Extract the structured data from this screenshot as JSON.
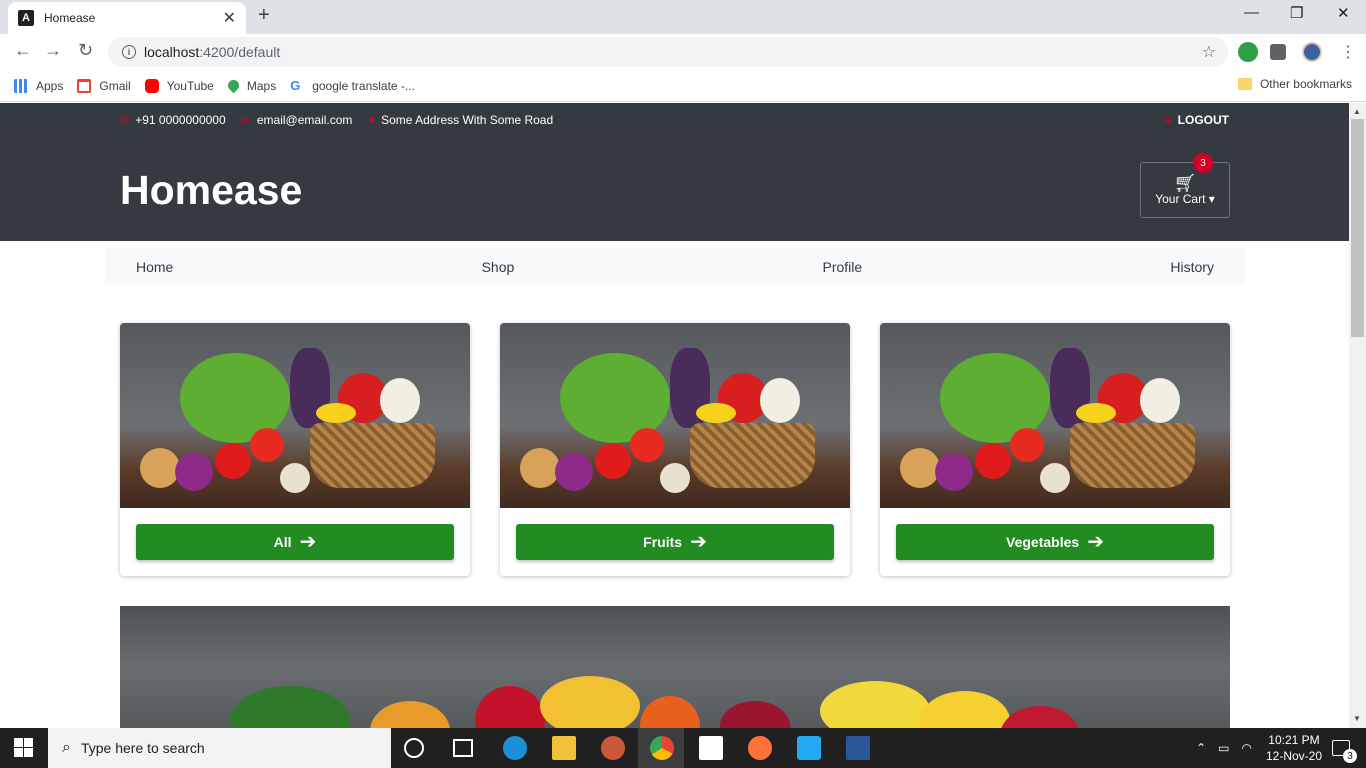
{
  "browser": {
    "tab_title": "Homease",
    "tab_icon": "angular-icon",
    "url_host": "localhost",
    "url_path": ":4200/default",
    "bookmarks": [
      {
        "label": "Apps",
        "icon": "apps-grid-icon"
      },
      {
        "label": "Gmail",
        "icon": "gmail-icon"
      },
      {
        "label": "YouTube",
        "icon": "youtube-icon"
      },
      {
        "label": "Maps",
        "icon": "maps-icon"
      },
      {
        "label": "google translate -...",
        "icon": "google-icon"
      }
    ],
    "other_bookmarks": "Other bookmarks"
  },
  "header": {
    "phone": "+91 0000000000",
    "email": "email@email.com",
    "address": "Some Address With Some Road",
    "logout": "LOGOUT",
    "brand": "Homease",
    "cart_label": "Your Cart",
    "cart_count": "3"
  },
  "nav": {
    "items": [
      "Home",
      "Shop",
      "Profile",
      "History"
    ]
  },
  "categories": [
    {
      "label": "All"
    },
    {
      "label": "Fruits"
    },
    {
      "label": "Vegetables"
    }
  ],
  "taskbar": {
    "search_placeholder": "Type here to search",
    "time": "10:21 PM",
    "date": "12-Nov-20",
    "notifications": "3"
  },
  "colors": {
    "header_bg": "#343a40",
    "accent_red": "#d10024",
    "button_green": "#228b22"
  }
}
